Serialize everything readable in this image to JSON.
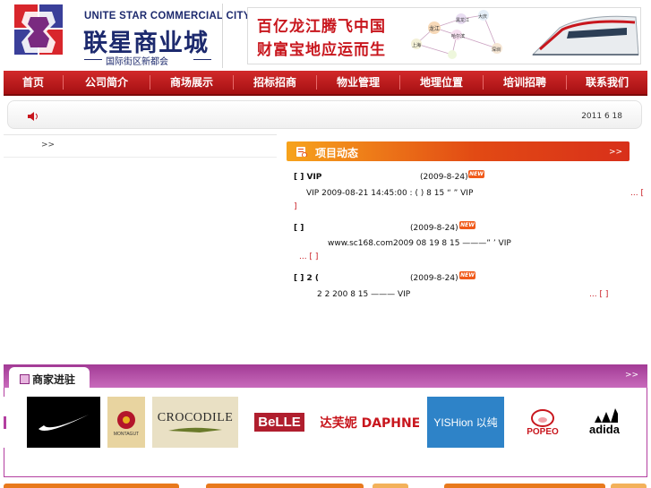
{
  "header": {
    "logo_en": "UNITE STAR COMMERCIAL CITY",
    "logo_cn": "联星商业城",
    "logo_sub": "国际街区新都会",
    "banner": {
      "line1": "百亿龙江腾飞中国",
      "line2": "财富宝地应运而生",
      "graph_nodes": [
        "黑龙江",
        "龙江",
        "哈尔滨",
        "大庆",
        "上海",
        "深圳"
      ]
    }
  },
  "nav": {
    "items": [
      "首页",
      "公司简介",
      "商场展示",
      "招标招商",
      "物业管理",
      "地理位置",
      "培训招聘",
      "联系我们"
    ]
  },
  "notice": {
    "date": "2011 6 18"
  },
  "left_panel": {
    "more": ">>"
  },
  "news": {
    "title": "项目动态",
    "more": ">>",
    "badge": "NEW",
    "items": [
      {
        "title": "[      ]           VIP",
        "date": "(2009-8-24)",
        "body": "VIP        2009-08-21 14:45:00  :   (    )               8 15          “   ”                VIP",
        "link": "... ["
      },
      {
        "title": "[      ]",
        "date": "(2009-8-24)",
        "body": "www.sc168.com2009 08 19                        8 15               ———”   ’   VIP",
        "link": "... [ ]"
      },
      {
        "title": "[      ]                   2      (",
        "date": "(2009-8-24)",
        "body": "2                       2                            200  8 15                ———              VIP",
        "link": "... [ ]"
      }
    ]
  },
  "merchants": {
    "title": "商家进驻",
    "more": ">>",
    "brands": [
      {
        "name": "nike",
        "label": ""
      },
      {
        "name": "montagut",
        "label": "MONTAGUT"
      },
      {
        "name": "crocodile",
        "label": "CROCODILE"
      },
      {
        "name": "belle",
        "label": "BeLLE"
      },
      {
        "name": "daphne",
        "label": "达芙妮 DAPHNE"
      },
      {
        "name": "yishion",
        "label": "YISHion 以纯"
      },
      {
        "name": "popeo",
        "label": "POPEO"
      },
      {
        "name": "adidas",
        "label": "adida"
      }
    ],
    "colors": {
      "accent": "#b33fa0"
    }
  },
  "colors": {
    "nav": "#b5161b",
    "brand_blue": "#1d2a6e",
    "news_orange": "#e8791c"
  }
}
